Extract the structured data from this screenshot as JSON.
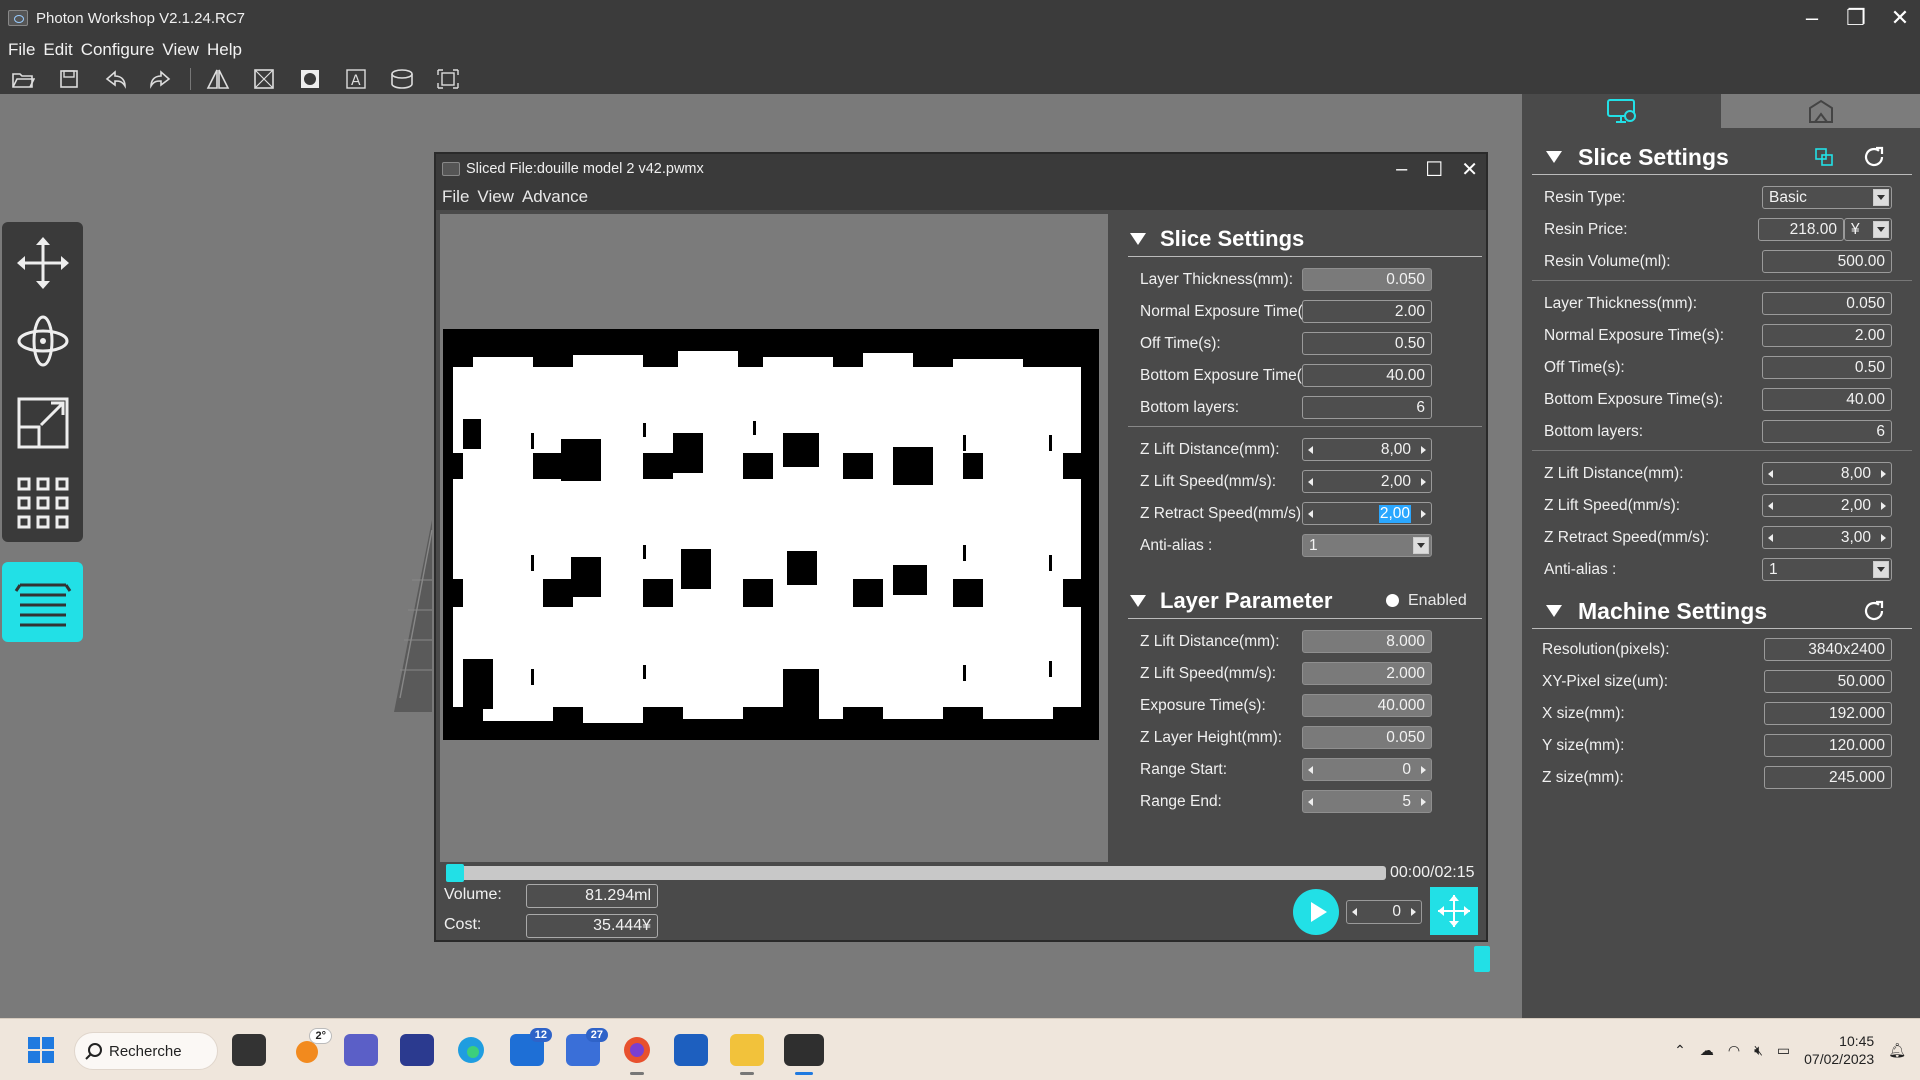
{
  "window": {
    "title": "Photon Workshop V2.1.24.RC7"
  },
  "menu": [
    "File",
    "Edit",
    "Configure",
    "View",
    "Help"
  ],
  "toolbar": [
    "open-icon",
    "save-icon",
    "undo-icon",
    "redo-icon",
    "mirror-icon",
    "hollow-icon",
    "hole-icon",
    "text-icon",
    "support-icon",
    "arrange-icon"
  ],
  "left_tools": [
    "move-icon",
    "rotate-icon",
    "scale-icon",
    "array-icon"
  ],
  "colors": {
    "accent": "#22e0e6",
    "panel": "#4a4a4a",
    "workspace": "#7a7a7a"
  },
  "right_panel": {
    "slice_settings": {
      "title": "Slice Settings",
      "resin_type_label": "Resin Type:",
      "resin_type": "Basic",
      "resin_price_label": "Resin Price:",
      "resin_price": "218.00",
      "currency": "¥",
      "resin_volume_label": "Resin Volume(ml):",
      "resin_volume": "500.00",
      "layer_thickness_label": "Layer Thickness(mm):",
      "layer_thickness": "0.050",
      "normal_exposure_label": "Normal Exposure Time(s):",
      "normal_exposure": "2.00",
      "off_time_label": "Off Time(s):",
      "off_time": "0.50",
      "bottom_exposure_label": "Bottom Exposure Time(s):",
      "bottom_exposure": "40.00",
      "bottom_layers_label": "Bottom layers:",
      "bottom_layers": "6",
      "z_lift_distance_label": "Z Lift Distance(mm):",
      "z_lift_distance": "8,00",
      "z_lift_speed_label": "Z Lift Speed(mm/s):",
      "z_lift_speed": "2,00",
      "z_retract_speed_label": "Z Retract Speed(mm/s):",
      "z_retract_speed": "3,00",
      "anti_alias_label": "Anti-alias :",
      "anti_alias": "1"
    },
    "machine_settings": {
      "title": "Machine Settings",
      "resolution_label": "Resolution(pixels):",
      "resolution": "3840x2400",
      "xy_pixel_label": "XY-Pixel size(um):",
      "xy_pixel": "50.000",
      "x_size_label": "X size(mm):",
      "x_size": "192.000",
      "y_size_label": "Y size(mm):",
      "y_size": "120.000",
      "z_size_label": "Z size(mm):",
      "z_size": "245.000"
    }
  },
  "sliced_window": {
    "title": "Sliced File:douille model 2 v42.pwmx",
    "menu": [
      "File",
      "View",
      "Advance"
    ],
    "slice_settings": {
      "title": "Slice Settings",
      "layer_thickness_label": "Layer Thickness(mm):",
      "layer_thickness": "0.050",
      "normal_exposure_label": "Normal Exposure Time(s):",
      "normal_exposure": "2.00",
      "off_time_label": "Off Time(s):",
      "off_time": "0.50",
      "bottom_exposure_label": "Bottom Exposure Time(s):",
      "bottom_exposure": "40.00",
      "bottom_layers_label": "Bottom layers:",
      "bottom_layers": "6",
      "z_lift_distance_label": "Z Lift Distance(mm):",
      "z_lift_distance": "8,00",
      "z_lift_speed_label": "Z Lift Speed(mm/s):",
      "z_lift_speed": "2,00",
      "z_retract_speed_label": "Z Retract Speed(mm/s):",
      "z_retract_speed": "2,00",
      "anti_alias_label": "Anti-alias :",
      "anti_alias": "1"
    },
    "layer_parameter": {
      "title": "Layer Parameter",
      "enabled_label": "Enabled",
      "z_lift_distance_label": "Z Lift Distance(mm):",
      "z_lift_distance": "8.000",
      "z_lift_speed_label": "Z Lift Speed(mm/s):",
      "z_lift_speed": "2.000",
      "exposure_label": "Exposure Time(s):",
      "exposure": "40.000",
      "z_layer_height_label": "Z Layer Height(mm):",
      "z_layer_height": "0.050",
      "range_start_label": "Range Start:",
      "range_start": "0",
      "range_end_label": "Range End:",
      "range_end": "5"
    },
    "playback": {
      "time": "00:00/02:15",
      "progress": 0.0,
      "volume_label": "Volume:",
      "volume": "81.294ml",
      "cost_label": "Cost:",
      "cost": "35.444¥",
      "layer": "0"
    }
  },
  "taskbar": {
    "search_label": "Recherche",
    "weather": "2°",
    "mail_badge": "12",
    "teams_badge": "27",
    "time": "10:45",
    "date": "07/02/2023"
  }
}
